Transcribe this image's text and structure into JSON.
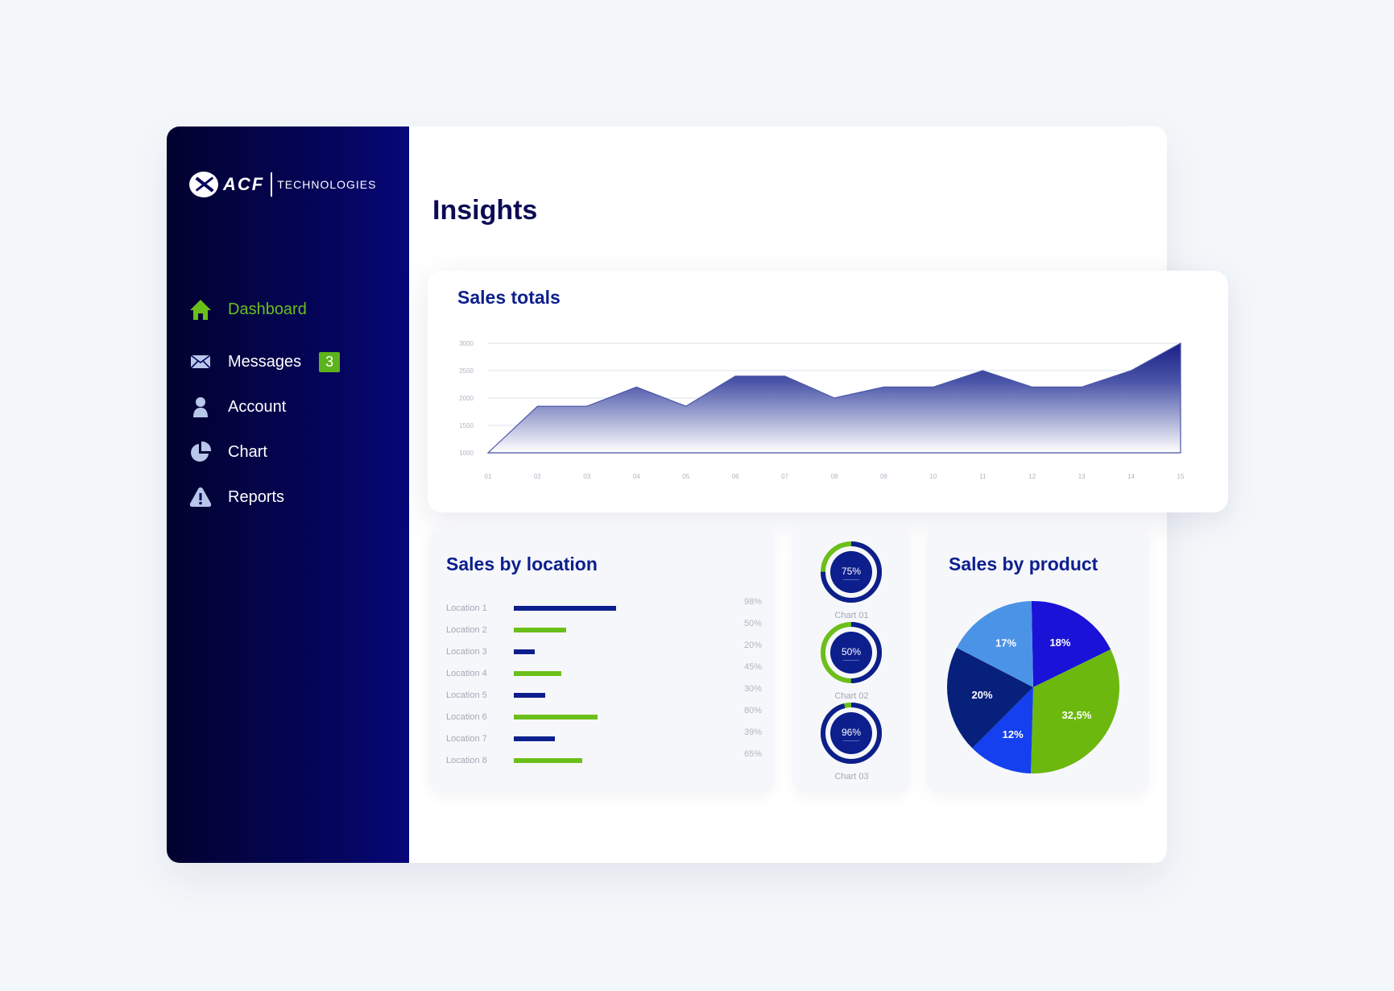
{
  "brand": {
    "name": "ACF",
    "tagline": "TECHNOLOGIES"
  },
  "sidebar": {
    "items": [
      {
        "label": "Dashboard",
        "icon": "home-icon",
        "active": true
      },
      {
        "label": "Messages",
        "icon": "envelope-icon",
        "badge": "3"
      },
      {
        "label": "Account",
        "icon": "user-icon"
      },
      {
        "label": "Chart",
        "icon": "pie-chart-icon"
      },
      {
        "label": "Reports",
        "icon": "warning-icon"
      }
    ]
  },
  "page": {
    "title": "Insights"
  },
  "colors": {
    "navy": "#0d1f8c",
    "green": "#6cbf1a",
    "sidebar": "#05055e"
  },
  "cards": {
    "totals_title": "Sales totals",
    "location_title": "Sales by location",
    "product_title": "Sales by product"
  },
  "chart_data": [
    {
      "type": "area",
      "title": "Sales totals",
      "x": [
        "01",
        "02",
        "03",
        "04",
        "05",
        "06",
        "07",
        "08",
        "09",
        "10",
        "11",
        "12",
        "13",
        "14",
        "15"
      ],
      "series": [
        {
          "name": "Sales",
          "values": [
            1000,
            1850,
            1850,
            2200,
            1850,
            2400,
            2400,
            2000,
            2200,
            2200,
            2500,
            2200,
            2200,
            2500,
            3000
          ]
        }
      ],
      "yticks": [
        "1000",
        "1500",
        "2000",
        "2500",
        "3000"
      ],
      "ylim": [
        1000,
        3000
      ],
      "grid": true
    },
    {
      "type": "bar",
      "orientation": "horizontal",
      "title": "Sales by location",
      "categories": [
        "Location 1",
        "Location 2",
        "Location 3",
        "Location 4",
        "Location 5",
        "Location 6",
        "Location 7",
        "Location 8"
      ],
      "values": [
        98,
        50,
        20,
        45,
        30,
        80,
        39,
        65
      ],
      "labels": [
        "98%",
        "50%",
        "20%",
        "45%",
        "30%",
        "80%",
        "39%",
        "65%"
      ]
    },
    {
      "type": "pie",
      "subtype": "donut",
      "items": [
        {
          "label": "Chart 01",
          "value": 75,
          "text": "75%"
        },
        {
          "label": "Chart 02",
          "value": 50,
          "text": "50%"
        },
        {
          "label": "Chart 03",
          "value": 96,
          "text": "96%"
        }
      ]
    },
    {
      "type": "pie",
      "title": "Sales by product",
      "slices": [
        {
          "label": "18%",
          "value": 18,
          "color": "#1a12d6"
        },
        {
          "label": "32,5%",
          "value": 32.5,
          "color": "#6cb80f"
        },
        {
          "label": "12%",
          "value": 12,
          "color": "#1440f0"
        },
        {
          "label": "20%",
          "value": 20,
          "color": "#07207c"
        },
        {
          "label": "17%",
          "value": 17,
          "color": "#4b93e6"
        }
      ]
    }
  ]
}
